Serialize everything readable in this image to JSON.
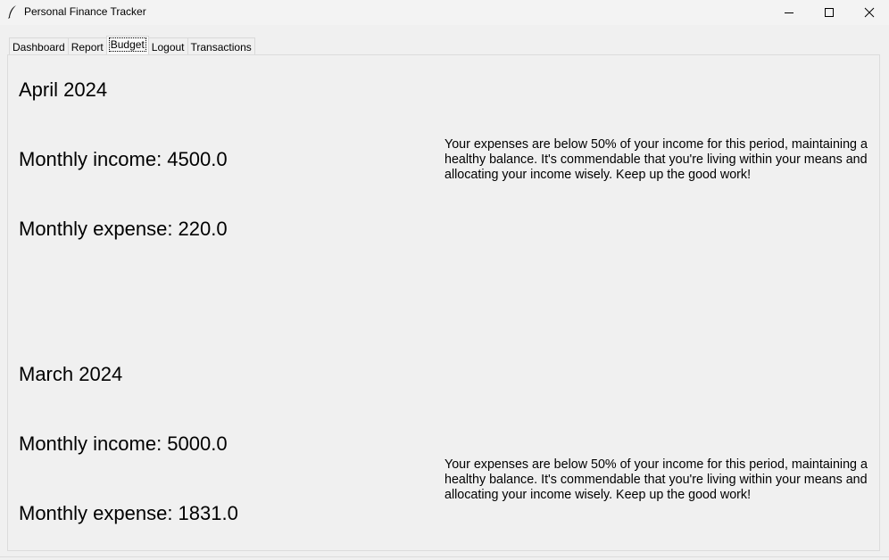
{
  "window": {
    "title": "Personal Finance Tracker"
  },
  "tabs": [
    {
      "label": "Dashboard"
    },
    {
      "label": "Report"
    },
    {
      "label": "Budget"
    },
    {
      "label": "Logout"
    },
    {
      "label": "Transactions"
    }
  ],
  "active_tab": "Budget",
  "budgets": [
    {
      "month": "April 2024",
      "income_label": "Monthly income: 4500.0",
      "expense_label": "Monthly expense: 220.0",
      "message": "Your expenses are below 50% of your income for this period, maintaining a healthy balance. It's commendable that you're living within your means and allocating your income wisely. Keep up the good work!"
    },
    {
      "month": "March 2024",
      "income_label": "Monthly income: 5000.0",
      "expense_label": "Monthly expense: 1831.0",
      "message": "Your expenses are below 50% of your income for this period, maintaining a healthy balance. It's commendable that you're living within your means and allocating your income wisely. Keep up the good work!"
    }
  ],
  "icons": {
    "app": "feather-icon",
    "minimize": "minimize-icon",
    "maximize": "maximize-icon",
    "close": "close-icon"
  }
}
